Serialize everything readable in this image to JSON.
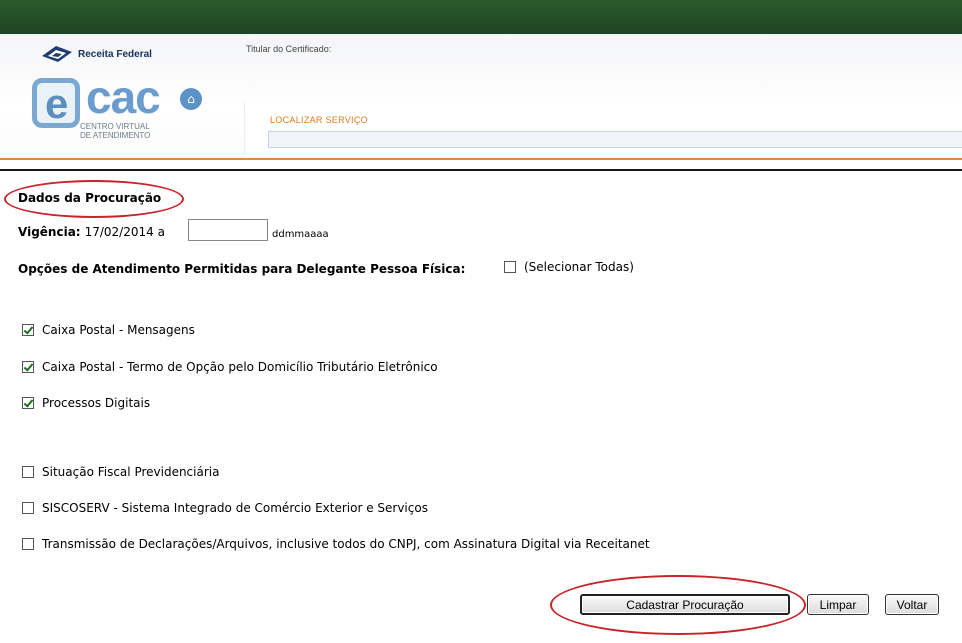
{
  "header": {
    "brand": "Receita Federal",
    "ecac_e": "e",
    "ecac_cac": "cac",
    "ecac_sub_line1": "CENTRO VIRTUAL",
    "ecac_sub_line2": "DE ATENDIMENTO",
    "titular_label": "Titular do Certificado:",
    "localizar_label": "LOCALIZAR SERVIÇO",
    "localizar_value": ""
  },
  "form": {
    "section_title": "Dados da Procuração",
    "vigencia_label": "Vigência:",
    "vigencia_start": "17/02/2014 a",
    "vigencia_end_value": "",
    "date_hint": "ddmmaaaa",
    "opcoes_label": "Opções de Atendimento Permitidas para Delegante Pessoa Física:",
    "select_all_label": "(Selecionar Todas)",
    "options": [
      {
        "label": "Caixa Postal - Mensagens",
        "checked": true
      },
      {
        "label": "Caixa Postal - Termo de Opção pelo Domicílio Tributário Eletrônico",
        "checked": true
      },
      {
        "label": "Processos Digitais",
        "checked": true
      },
      {
        "label": "Situação Fiscal Previdenciária",
        "checked": false
      },
      {
        "label": "SISCOSERV - Sistema Integrado de Comércio Exterior e Serviços",
        "checked": false
      },
      {
        "label": "Transmissão de Declarações/Arquivos, inclusive todos do CNPJ, com Assinatura Digital via Receitanet",
        "checked": false
      }
    ]
  },
  "buttons": {
    "cadastrar": "Cadastrar Procuração",
    "limpar": "Limpar",
    "voltar": "Voltar"
  },
  "colors": {
    "topbar": "#1f4522",
    "accent_orange": "#e58a2e",
    "highlight_red": "#c8242a",
    "ecac_blue": "#6a9ccd"
  }
}
